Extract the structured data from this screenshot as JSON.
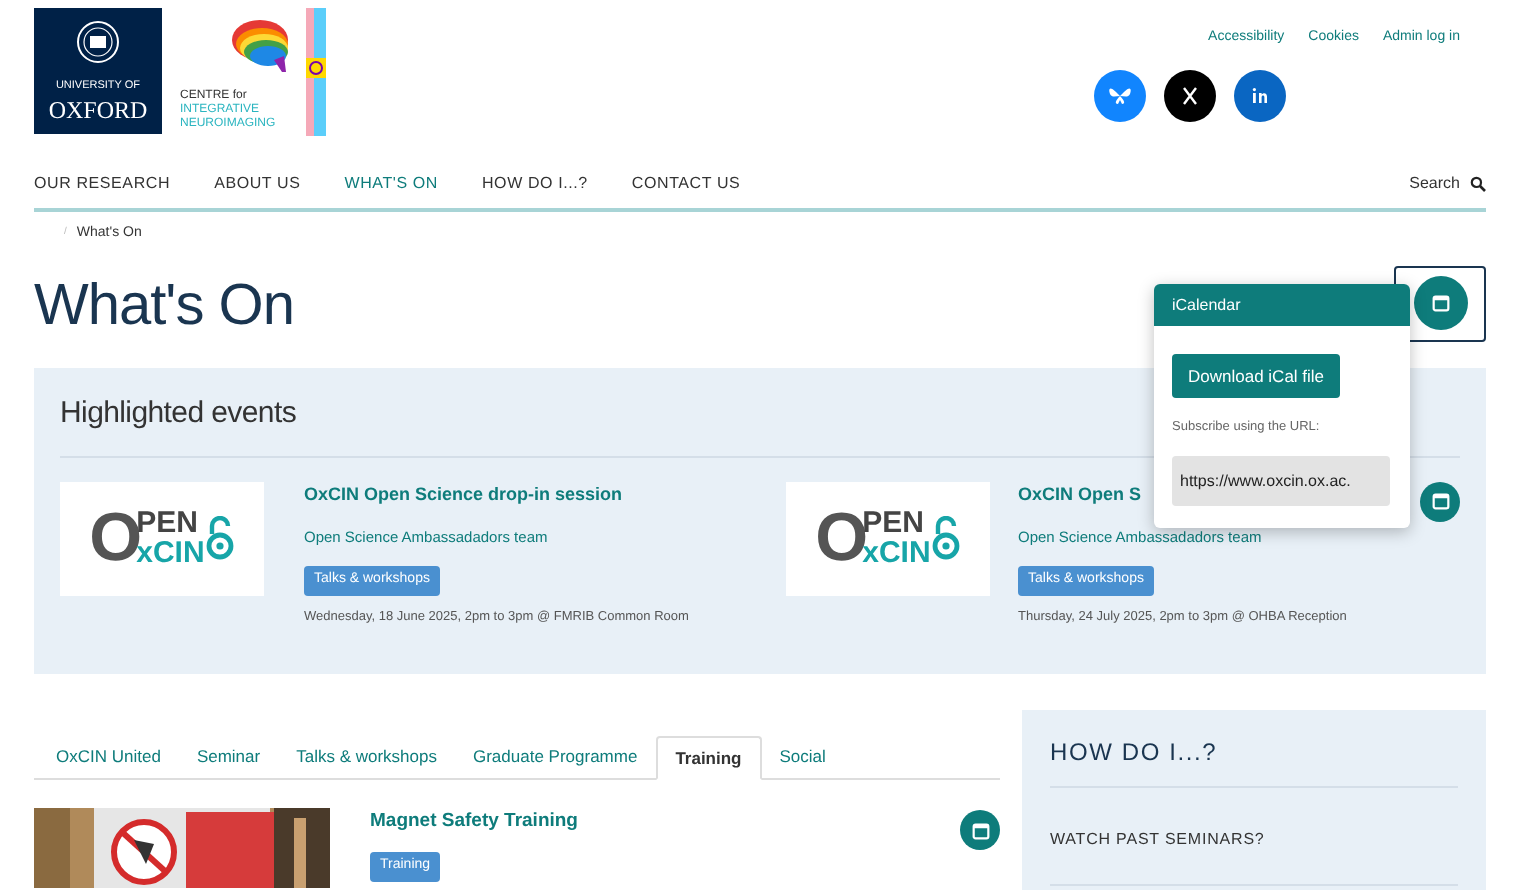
{
  "header": {
    "oxford_logo": [
      "UNIVERSITY OF",
      "OXFORD"
    ],
    "centre_logo": [
      "CENTRE for",
      "INTEGRATIVE",
      "NEUROIMAGING"
    ],
    "top_links": [
      "Accessibility",
      "Cookies",
      "Admin log in"
    ],
    "social": [
      {
        "kind": "bluesky",
        "color": "#1185fe"
      },
      {
        "kind": "x",
        "color": "#000000"
      },
      {
        "kind": "linkedin",
        "color": "#0a66c2"
      }
    ]
  },
  "nav": {
    "items": [
      {
        "label": "OUR RESEARCH",
        "selected": false
      },
      {
        "label": "ABOUT US",
        "selected": false
      },
      {
        "label": "WHAT'S ON",
        "selected": true
      },
      {
        "label": "HOW DO I...?",
        "selected": false
      },
      {
        "label": "CONTACT US",
        "selected": false
      }
    ],
    "search": "Search"
  },
  "breadcrumb": {
    "separator": "/",
    "items": [
      "What's On"
    ]
  },
  "title": "What's On",
  "icalendar": {
    "title": "iCalendar",
    "download": "Download iCal file",
    "subscribe_label": "Subscribe using the URL:",
    "url": "https://www.oxcin.ox.ac."
  },
  "highlighted": {
    "heading": "Highlighted events",
    "events": [
      {
        "logo": [
          "O",
          "PEN",
          "xCIN"
        ],
        "title": "OxCIN Open Science drop-in session",
        "team": "Open Science Ambassadadors team",
        "tag": "Talks & workshops",
        "when": "Wednesday, 18 June 2025, 2pm to 3pm @ FMRIB Common Room",
        "calendar": false
      },
      {
        "logo": [
          "O",
          "PEN",
          "xCIN"
        ],
        "title": "OxCIN Open S",
        "team": "Open Science Ambassadadors team",
        "tag": "Talks & workshops",
        "when": "Thursday, 24 July 2025, 2pm to 3pm @ OHBA Reception",
        "calendar": true
      }
    ]
  },
  "tabs": [
    {
      "label": "OxCIN United",
      "selected": false
    },
    {
      "label": "Seminar",
      "selected": false
    },
    {
      "label": "Talks & workshops",
      "selected": false
    },
    {
      "label": "Graduate Programme",
      "selected": false
    },
    {
      "label": "Training",
      "selected": true
    },
    {
      "label": "Social",
      "selected": false
    }
  ],
  "listing": [
    {
      "kind": "picture",
      "title": "Magnet Safety Training",
      "tag": "Training"
    }
  ],
  "sidebar": {
    "heading": "HOW DO I...?",
    "links": [
      "WATCH PAST SEMINARS?"
    ]
  }
}
